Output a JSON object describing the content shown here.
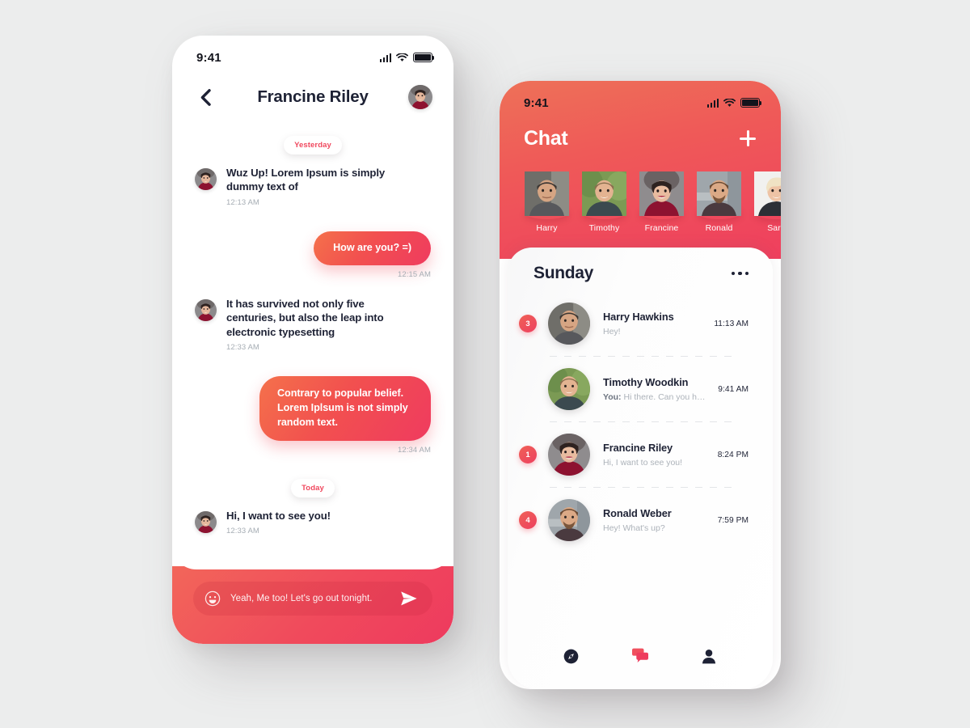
{
  "chat_thread": {
    "status_bar": {
      "time": "9:41"
    },
    "header": {
      "title": "Francine Riley",
      "back_icon": "chevron-left-icon",
      "avatar_alt": "Francine Riley"
    },
    "day_separators": {
      "yesterday": "Yesterday",
      "today": "Today"
    },
    "messages": [
      {
        "side": "in",
        "text": "Wuz Up! Lorem Ipsum is simply dummy text of",
        "time": "12:13 AM"
      },
      {
        "side": "out",
        "text": "How are you? =)",
        "time": "12:15 AM"
      },
      {
        "side": "in",
        "text": "It has survived not only five centuries, but also the leap into electronic typesetting",
        "time": "12:33 AM"
      },
      {
        "side": "out",
        "text": "Contrary to popular belief. Lorem Iplsum is not simply random text.",
        "time": "12:34 AM"
      },
      {
        "side": "in",
        "text": "Hi, I want to see you!",
        "time": "12:33 AM"
      }
    ],
    "composer": {
      "placeholder": "Yeah, Me too! Let's go out tonight.",
      "value": "",
      "emoji_icon": "smiley-icon",
      "send_icon": "send-paper-plane-icon"
    }
  },
  "chat_list": {
    "status_bar": {
      "time": "9:41"
    },
    "header": {
      "title": "Chat",
      "add_icon": "plus-icon"
    },
    "stories": [
      {
        "name": "Harry"
      },
      {
        "name": "Timothy"
      },
      {
        "name": "Francine"
      },
      {
        "name": "Ronald"
      },
      {
        "name": "Sara"
      }
    ],
    "card": {
      "title": "Sunday",
      "menu_icon": "more-horizontal-icon"
    },
    "conversations": [
      {
        "badge": "3",
        "name": "Harry Hawkins",
        "preview_prefix": "",
        "preview": "Hey!",
        "time": "11:13 AM"
      },
      {
        "badge": "",
        "name": "Timothy Woodkin",
        "preview_prefix": "You:",
        "preview": "Hi there. Can you help me?",
        "time": "9:41 AM"
      },
      {
        "badge": "1",
        "name": "Francine Riley",
        "preview_prefix": "",
        "preview": "Hi, I want to see you!",
        "time": "8:24 PM"
      },
      {
        "badge": "4",
        "name": "Ronald Weber",
        "preview_prefix": "",
        "preview": "Hey! What's up?",
        "time": "7:59 PM"
      }
    ],
    "tabbar": [
      {
        "icon": "explore-compass-icon",
        "active": false
      },
      {
        "icon": "chat-bubbles-icon",
        "active": true
      },
      {
        "icon": "person-profile-icon",
        "active": false
      }
    ]
  },
  "theme": {
    "accent_start": "#F2665A",
    "accent_end": "#EE3A5E",
    "ink": "#1E2235",
    "muted": "#ADB3BA",
    "page_bg": "#ECEDED"
  }
}
